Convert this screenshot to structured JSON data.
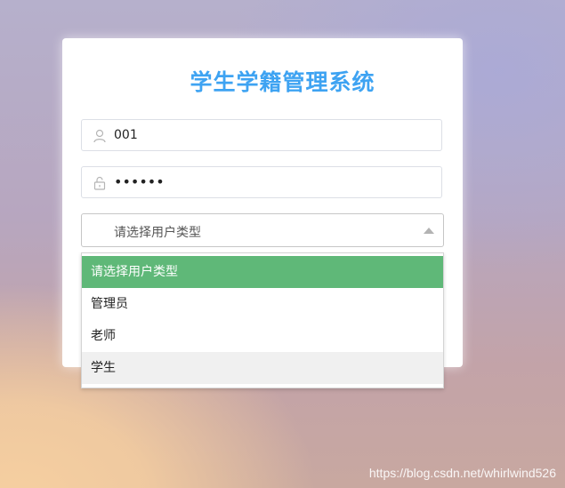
{
  "title": "学生学籍管理系统",
  "username": {
    "value": "001",
    "icon": "user-icon"
  },
  "password": {
    "value": "••••••",
    "icon": "lock-icon"
  },
  "user_type": {
    "selected_label": "请选择用户类型",
    "options": [
      "请选择用户类型",
      "管理员",
      "老师",
      "学生"
    ]
  },
  "watermark": "https://blog.csdn.net/whirlwind526",
  "colors": {
    "title": "#3ea3f2",
    "selected_option": "#5fb878"
  }
}
